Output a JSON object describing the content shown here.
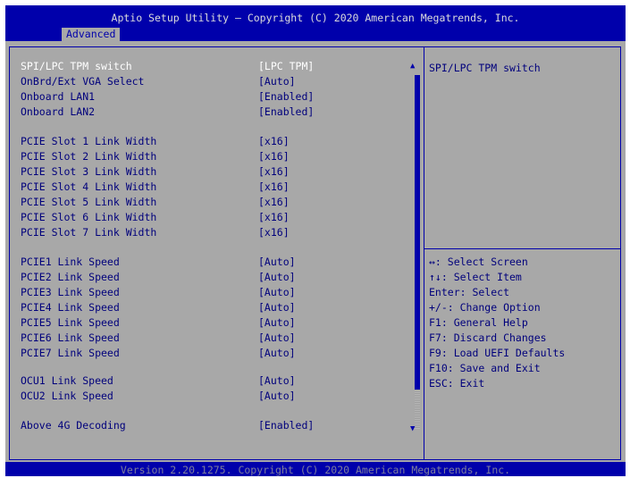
{
  "header": {
    "title": "Aptio Setup Utility – Copyright (C) 2020 American Megatrends, Inc.",
    "tab": "Advanced"
  },
  "settings": [
    {
      "label": "SPI/LPC TPM switch",
      "value": "[LPC TPM]",
      "selected": true
    },
    {
      "label": "OnBrd/Ext VGA Select",
      "value": "[Auto]"
    },
    {
      "label": "Onboard LAN1",
      "value": "[Enabled]"
    },
    {
      "label": "Onboard LAN2",
      "value": "[Enabled]"
    },
    {
      "label": "PCIE Slot 1 Link Width",
      "value": "[x16]"
    },
    {
      "label": "PCIE Slot 2 Link Width",
      "value": "[x16]"
    },
    {
      "label": "PCIE Slot 3 Link Width",
      "value": "[x16]"
    },
    {
      "label": "PCIE Slot 4 Link Width",
      "value": "[x16]"
    },
    {
      "label": "PCIE Slot 5 Link Width",
      "value": "[x16]"
    },
    {
      "label": "PCIE Slot 6 Link Width",
      "value": "[x16]"
    },
    {
      "label": "PCIE Slot 7 Link Width",
      "value": "[x16]"
    },
    {
      "label": "PCIE1 Link Speed",
      "value": "[Auto]"
    },
    {
      "label": "PCIE2 Link Speed",
      "value": "[Auto]"
    },
    {
      "label": "PCIE3 Link Speed",
      "value": "[Auto]"
    },
    {
      "label": "PCIE4 Link Speed",
      "value": "[Auto]"
    },
    {
      "label": "PCIE5 Link Speed",
      "value": "[Auto]"
    },
    {
      "label": "PCIE6 Link Speed",
      "value": "[Auto]"
    },
    {
      "label": "PCIE7 Link Speed",
      "value": "[Auto]"
    },
    {
      "label": "OCU1 Link Speed",
      "value": "[Auto]"
    },
    {
      "label": "OCU2 Link Speed",
      "value": "[Auto]"
    },
    {
      "label": "Above 4G Decoding",
      "value": "[Enabled]"
    }
  ],
  "help": {
    "text": "SPI/LPC TPM switch"
  },
  "keys": [
    "↔: Select Screen",
    "↑↓: Select Item",
    "Enter: Select",
    "+/-: Change Option",
    "F1: General Help",
    "F7: Discard Changes",
    "F9: Load UEFI Defaults",
    "F10: Save and Exit",
    "ESC: Exit"
  ],
  "footer": {
    "text": "Version 2.20.1275. Copyright (C) 2020 American Megatrends, Inc."
  },
  "colors": {
    "blue": "#0000ab",
    "gray": "#a8a8a8",
    "text": "#00007c",
    "highlight": "#ffffff"
  }
}
